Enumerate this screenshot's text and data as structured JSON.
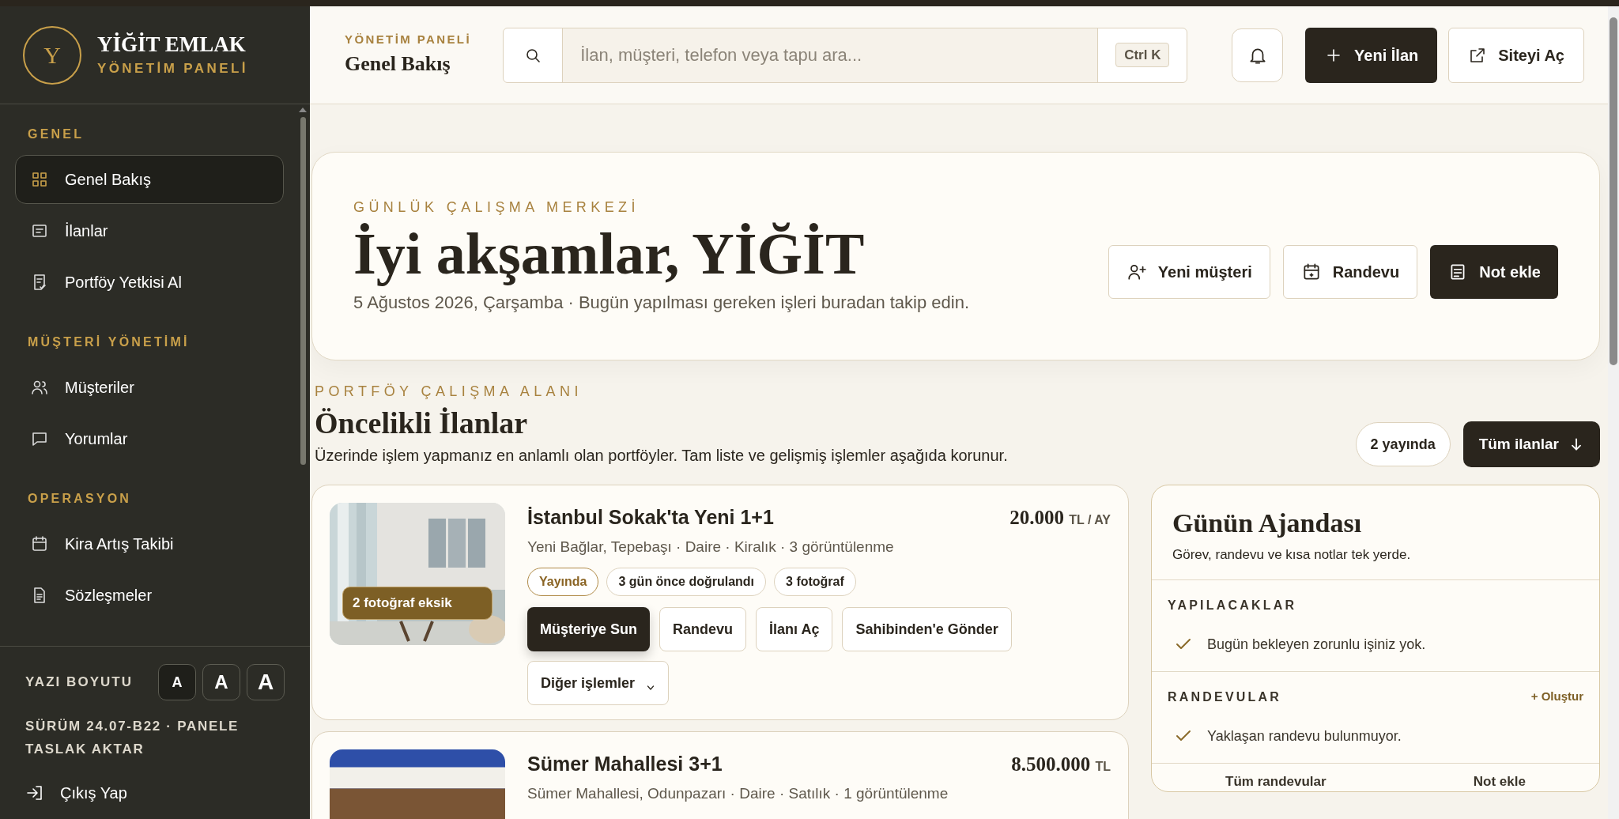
{
  "sidebar": {
    "brand": {
      "initial": "Y",
      "name": "YİĞİT EMLAK",
      "subtitle": "YÖNETİM PANELİ"
    },
    "sections": [
      {
        "title": "GENEL",
        "items": [
          {
            "label": "Genel Bakış",
            "selected": true
          },
          {
            "label": "İlanlar",
            "selected": false
          },
          {
            "label": "Portföy Yetkisi Al",
            "selected": false
          }
        ]
      },
      {
        "title": "MÜŞTERİ YÖNETİMİ",
        "items": [
          {
            "label": "Müşteriler",
            "selected": false
          },
          {
            "label": "Yorumlar",
            "selected": false
          }
        ]
      },
      {
        "title": "OPERASYON",
        "items": [
          {
            "label": "Kira Artış Takibi",
            "selected": false
          },
          {
            "label": "Sözleşmeler",
            "selected": false
          }
        ]
      }
    ],
    "font_size": {
      "label": "YAZI BOYUTU",
      "options": [
        {
          "label": "A",
          "selected": true
        },
        {
          "label": "A",
          "selected": false
        },
        {
          "label": "A",
          "selected": false
        }
      ]
    },
    "version": "SÜRÜM 24.07-B22 · PANELE TASLAK AKTAR",
    "logout": "Çıkış Yap"
  },
  "header": {
    "eyebrow": "YÖNETİM PANELİ",
    "title": "Genel Bakış",
    "search": {
      "placeholder": "İlan, müşteri, telefon veya tapu ara...",
      "shortcut": "Ctrl K"
    },
    "buttons": [
      {
        "label": "Yeni İlan",
        "kind": "primary"
      },
      {
        "label": "Siteyi Aç",
        "kind": "secondary"
      }
    ]
  },
  "hero": {
    "eyebrow": "GÜNLÜK ÇALIŞMA MERKEZİ",
    "title": "İyi akşamlar, YİĞİT",
    "subtitle": "5 Ağustos 2026, Çarşamba · Bugün yapılması gereken işleri buradan takip edin.",
    "buttons": [
      {
        "label": "Yeni müşteri",
        "kind": "secondary"
      },
      {
        "label": "Randevu",
        "kind": "secondary"
      },
      {
        "label": "Not ekle",
        "kind": "primary"
      }
    ]
  },
  "listings": {
    "eyebrow": "PORTFÖY ÇALIŞMA ALANI",
    "title": "Öncelikli İlanlar",
    "subtitle": "Üzerinde işlem yapmanız en anlamlı olan portföyler. Tam liste ve gelişmiş işlemler aşağıda korunur.",
    "count": "2 yayında",
    "all_button": "Tüm ilanlar",
    "items": [
      {
        "title": "İstanbul Sokak'ta Yeni 1+1",
        "price": "20.000",
        "unit": "TL / AY",
        "meta": "Yeni Bağlar, Tepebaşı · Daire · Kiralık · 3 görüntülenme",
        "photo_badge": "2 fotoğraf eksik",
        "tags": [
          {
            "label": "Yayında",
            "kind": "status"
          },
          {
            "label": "3 gün önce doğrulandı",
            "kind": "info"
          },
          {
            "label": "3 fotoğraf",
            "kind": "info"
          }
        ],
        "actions": [
          {
            "label": "Müşteriye Sun",
            "kind": "primary"
          },
          {
            "label": "Randevu",
            "kind": "secondary"
          },
          {
            "label": "İlanı Aç",
            "kind": "secondary"
          },
          {
            "label": "Sahibinden'e Gönder",
            "kind": "secondary"
          },
          {
            "label": "Diğer işlemler",
            "kind": "menu"
          }
        ]
      },
      {
        "title": "Sümer Mahallesi 3+1",
        "price": "8.500.000",
        "unit": "TL",
        "meta": "Sümer Mahallesi, Odunpazarı · Daire · Satılık · 1 görüntülenme"
      }
    ]
  },
  "agenda": {
    "title": "Günün Ajandası",
    "subtitle": "Görev, randevu ve kısa notlar tek yerde.",
    "sections": [
      {
        "title": "YAPILACAKLAR",
        "empty": "Bugün bekleyen zorunlu işiniz yok."
      },
      {
        "title": "RANDEVULAR",
        "action": "+ Oluştur",
        "empty": "Yaklaşan randevu bulunmuyor."
      }
    ],
    "footer": [
      "Tüm randevular",
      "Not ekle"
    ]
  }
}
